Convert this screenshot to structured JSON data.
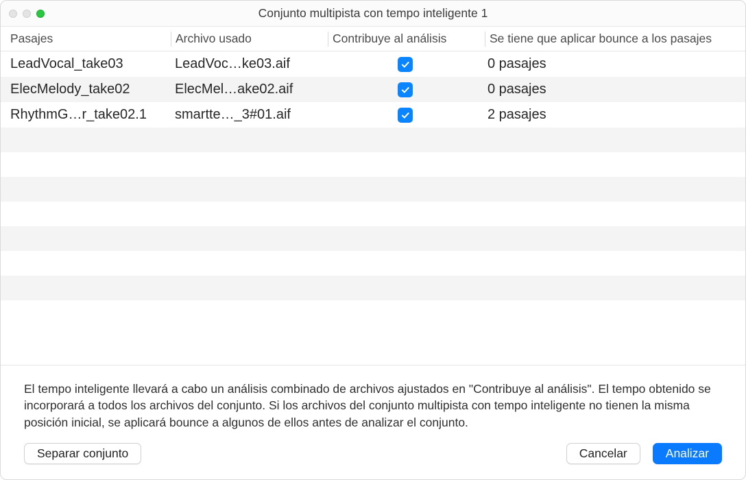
{
  "window": {
    "title": "Conjunto multipista con tempo inteligente 1"
  },
  "columns": {
    "pasajes": "Pasajes",
    "archivo": "Archivo usado",
    "contribuye": "Contribuye al análisis",
    "bounce": "Se tiene que aplicar bounce a los pasajes"
  },
  "rows": [
    {
      "pasaje": "LeadVocal_take03",
      "archivo": "LeadVoc…ke03.aif",
      "contribuye": true,
      "bounce": "0 pasajes"
    },
    {
      "pasaje": "ElecMelody_take02",
      "archivo": "ElecMel…ake02.aif",
      "contribuye": true,
      "bounce": "0 pasajes"
    },
    {
      "pasaje": "RhythmG…r_take02.1",
      "archivo": "smartte…_3#01.aif",
      "contribuye": true,
      "bounce": "2 pasajes"
    }
  ],
  "footer": {
    "text": "El tempo inteligente llevará a cabo un análisis combinado de archivos ajustados en \"Contribuye al análisis\". El tempo obtenido se incorporará a todos los archivos del conjunto. Si los archivos del conjunto multipista con tempo inteligente no tienen la misma posición inicial, se aplicará bounce a algunos de ellos antes de analizar el conjunto.",
    "separate": "Separar conjunto",
    "cancel": "Cancelar",
    "analyze": "Analizar"
  }
}
